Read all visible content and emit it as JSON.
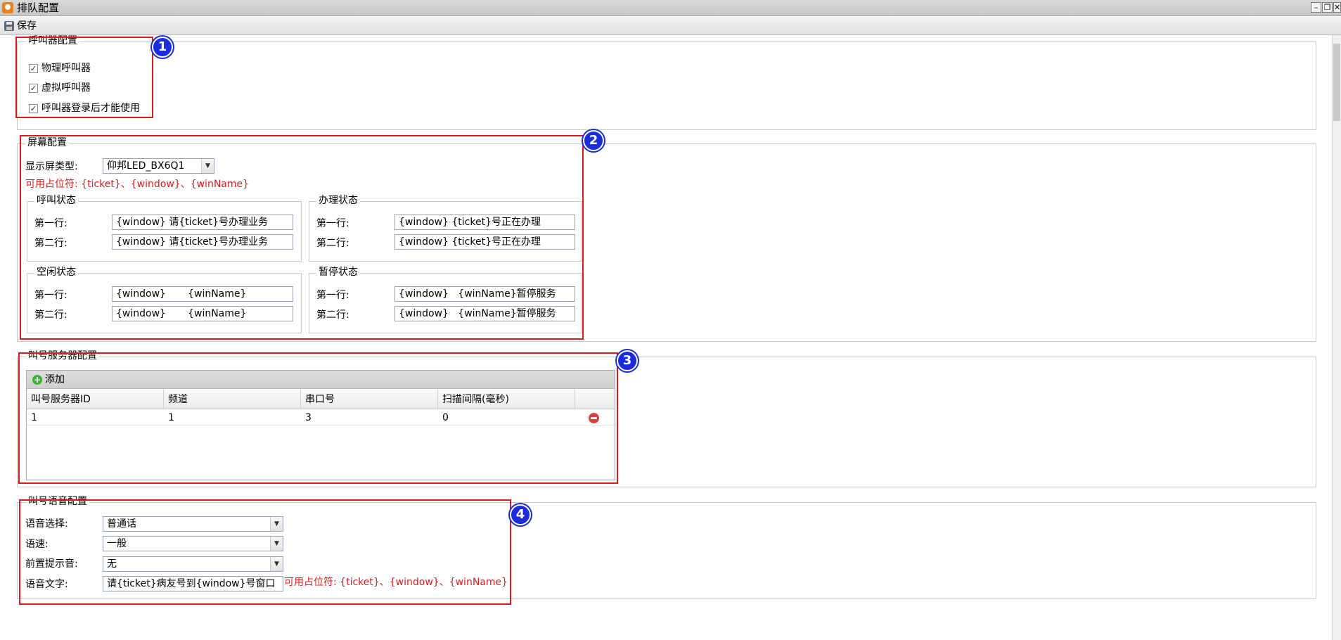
{
  "window": {
    "title": "排队配置",
    "minimize_label": "–",
    "restore_label": "❐",
    "close_label": "✕"
  },
  "toolbar": {
    "save_label": "保存"
  },
  "caller_config": {
    "legend": "呼叫器配置",
    "badge": "1",
    "options": [
      {
        "label": "物理呼叫器",
        "checked": true
      },
      {
        "label": "虚拟呼叫器",
        "checked": true
      },
      {
        "label": "呼叫器登录后才能使用",
        "checked": true
      }
    ]
  },
  "screen_config": {
    "legend": "屏幕配置",
    "badge": "2",
    "display_type_label": "显示屏类型:",
    "display_type_value": "仰邦LED_BX6Q1",
    "placeholder_hint": "可用占位符: {ticket}、{window}、{winName}",
    "states": {
      "call": {
        "legend": "呼叫状态",
        "line1_label": "第一行:",
        "line1": "{window}  请{ticket}号办理业务",
        "line2_label": "第二行:",
        "line2": "{window}  请{ticket}号办理业务"
      },
      "processing": {
        "legend": "办理状态",
        "line1_label": "第一行:",
        "line1": "{window}   {ticket}号正在办理",
        "line2_label": "第二行:",
        "line2": "{window}   {ticket}号正在办理"
      },
      "idle": {
        "legend": "空闲状态",
        "line1_label": "第一行:",
        "line1": "{window}       {winName}",
        "line2_label": "第二行:",
        "line2": "{window}       {winName}"
      },
      "paused": {
        "legend": "暂停状态",
        "line1_label": "第一行:",
        "line1": "{window}   {winName}暂停服务",
        "line2_label": "第二行:",
        "line2": "{window}   {winName}暂停服务"
      }
    }
  },
  "server_config": {
    "legend": "叫号服务器配置",
    "badge": "3",
    "add_label": "添加",
    "columns": [
      "叫号服务器ID",
      "频道",
      "串口号",
      "扫描间隔(毫秒)"
    ],
    "rows": [
      {
        "id": "1",
        "channel": "1",
        "port": "3",
        "interval": "0"
      }
    ]
  },
  "voice_config": {
    "legend": "叫号语音配置",
    "badge": "4",
    "voice_label": "语音选择:",
    "voice_value": "普通话",
    "speed_label": "语速:",
    "speed_value": "一般",
    "prompt_label": "前置提示音:",
    "prompt_value": "无",
    "text_label": "语音文字:",
    "text_value": "请{ticket}病友号到{window}号窗口",
    "placeholder_hint": "可用占位符: {ticket}、{window}、{winName}"
  }
}
